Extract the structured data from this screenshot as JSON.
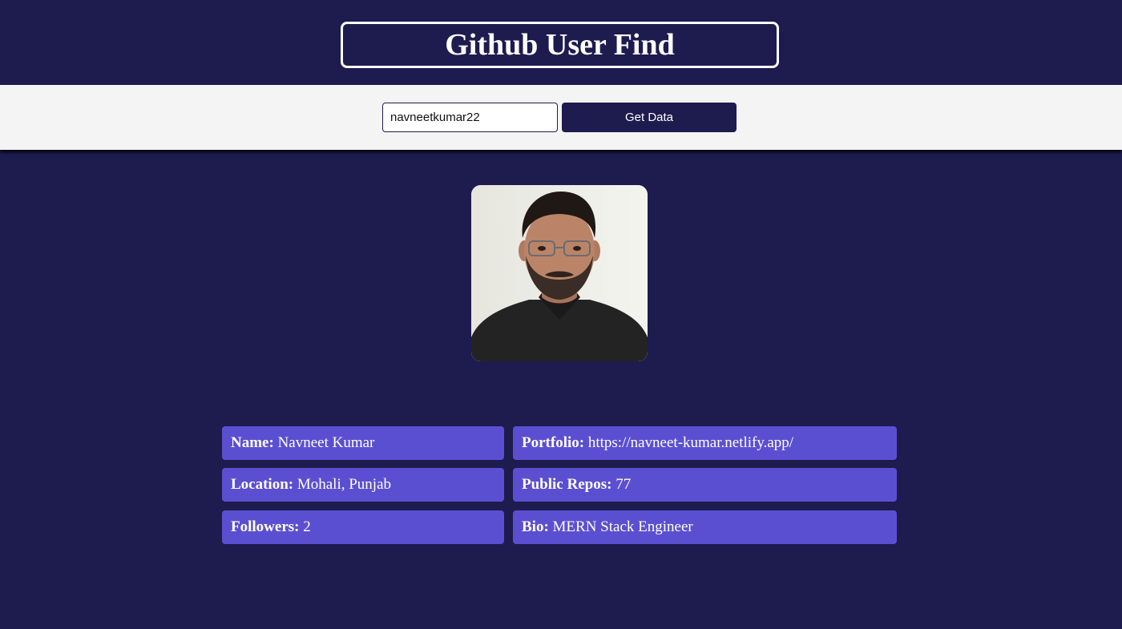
{
  "header": {
    "title": "Github User Find"
  },
  "search": {
    "value": "navneetkumar22",
    "button_label": "Get Data"
  },
  "profile": {
    "avatar_icon": "user-photo",
    "fields": {
      "name": {
        "label": "Name:",
        "value": "Navneet Kumar"
      },
      "portfolio": {
        "label": "Portfolio:",
        "value": "https://navneet-kumar.netlify.app/"
      },
      "location": {
        "label": "Location:",
        "value": "Mohali, Punjab"
      },
      "public_repos": {
        "label": "Public Repos:",
        "value": "77"
      },
      "followers": {
        "label": "Followers:",
        "value": "2"
      },
      "bio": {
        "label": "Bio:",
        "value": "MERN Stack Engineer"
      }
    }
  },
  "colors": {
    "background": "#1e1b4f",
    "card": "#5b4fd1",
    "search_bar": "#f4f4f4",
    "text_light": "#ffffff"
  }
}
